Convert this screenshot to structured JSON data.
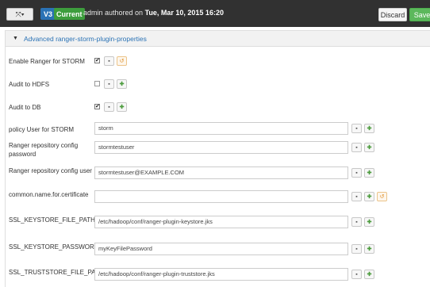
{
  "topbar": {
    "branch_icon": "⤧▾",
    "version_badge": "V3",
    "current_badge": "Current",
    "authored_prefix": "admin authored on ",
    "authored_date": "Tue, Mar 10, 2015 16:20",
    "discard_label": "Discard",
    "save_label": "Save"
  },
  "panel": {
    "caret": "▼",
    "title": "Advanced ranger-storm-plugin-properties"
  },
  "properties": [
    {
      "label": "Enable Ranger for STORM",
      "type": "checkbox",
      "checked": true,
      "icons": [
        "lock-icon",
        "undo-icon"
      ]
    },
    {
      "label": "Audit to HDFS",
      "type": "checkbox",
      "checked": false,
      "icons": [
        "lock-icon",
        "plus-icon"
      ]
    },
    {
      "label": "Audit to DB",
      "type": "checkbox",
      "checked": true,
      "icons": [
        "lock-icon",
        "plus-icon"
      ]
    },
    {
      "label": "policy User for STORM",
      "type": "text",
      "value": "storm",
      "icons": [
        "lock-icon",
        "plus-icon"
      ]
    },
    {
      "label": "Ranger repository config password",
      "type": "text",
      "value": "stormtestuser",
      "icons": [
        "lock-icon",
        "plus-icon"
      ]
    },
    {
      "label": "Ranger repository config user",
      "type": "text",
      "value": "stormtestuser@EXAMPLE.COM",
      "icons": [
        "lock-icon",
        "plus-icon"
      ]
    },
    {
      "label": "common.name.for.certificate",
      "type": "text",
      "value": "",
      "icons": [
        "lock-icon",
        "plus-icon",
        "undo-icon"
      ]
    },
    {
      "label": "SSL_KEYSTORE_FILE_PATH",
      "type": "text",
      "value": "/etc/hadoop/conf/ranger-plugin-keystore.jks",
      "icons": [
        "lock-icon",
        "plus-icon"
      ]
    },
    {
      "label": "SSL_KEYSTORE_PASSWORD",
      "type": "text",
      "value": "myKeyFilePassword",
      "icons": [
        "lock-icon",
        "plus-icon"
      ]
    },
    {
      "label": "SSL_TRUSTSTORE_FILE_PATH",
      "type": "text",
      "value": "/etc/hadoop/conf/ranger-plugin-truststore.jks",
      "icons": [
        "lock-icon",
        "plus-icon"
      ]
    }
  ],
  "glyphs": {
    "check": "✔",
    "lock": "🔒︎",
    "plus": "✚",
    "undo": "↺"
  },
  "colors": {
    "topbar": "#313131",
    "accent": "#2a72b5",
    "save": "#5cb85c",
    "current": "#3d9d3d"
  }
}
